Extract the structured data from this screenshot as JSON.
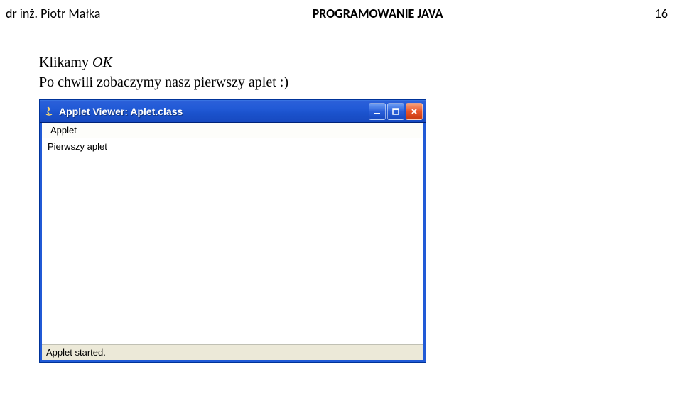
{
  "header": {
    "author": "dr inż. Piotr Małka",
    "title": "PROGRAMOWANIE JAVA",
    "page": "16"
  },
  "body": {
    "line1_prefix": "Klikamy ",
    "line1_italic": "OK",
    "line2": "Po chwili zobaczymy nasz pierwszy aplet :)"
  },
  "window": {
    "title": "Applet Viewer: Aplet.class",
    "menu": {
      "applet": "Applet"
    },
    "content": "Pierwszy aplet",
    "status": "Applet started."
  }
}
